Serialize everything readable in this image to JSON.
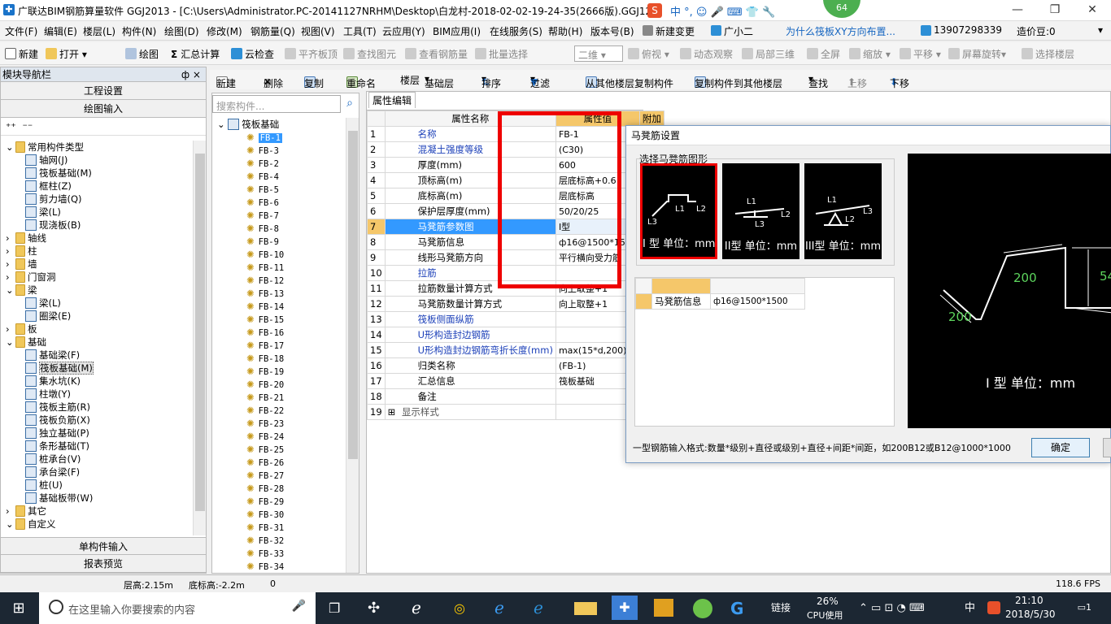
{
  "window": {
    "title": "广联达BIM钢筋算量软件 GGJ2013 - [C:\\Users\\Administrator.PC-20141127NRHM\\Desktop\\白龙村-2018-02-02-19-24-35(2666版).GGJ12]",
    "badge": "64"
  },
  "menu": {
    "items": [
      "文件(F)",
      "编辑(E)",
      "楼层(L)",
      "构件(N)",
      "绘图(D)",
      "修改(M)",
      "钢筋量(Q)",
      "视图(V)",
      "工具(T)",
      "云应用(Y)",
      "BIM应用(I)",
      "在线服务(S)",
      "帮助(H)",
      "版本号(B)"
    ],
    "new_change": "新建变更",
    "xiaoer": "广小二",
    "question": "为什么筏板XY方向布置...",
    "phone": "13907298339",
    "price_bean": "造价豆:0"
  },
  "toolbar1": {
    "new": "新建",
    "open": "打开",
    "draw": "绘图",
    "calc": "汇总计算",
    "cloud_check": "云检查",
    "align_top": "平齐板顶",
    "find_elem": "查找图元",
    "view_rebar": "查看钢筋量",
    "batch_select": "批量选择",
    "view_mode": "二维",
    "top_view": "俯视",
    "dynamic": "动态观察",
    "local_3d": "局部三维",
    "fullscreen": "全屏",
    "zoom": "缩放",
    "pan": "平移",
    "rotate": "屏幕旋转",
    "select_floor": "选择楼层"
  },
  "toolbar2": {
    "new": "新建",
    "delete": "删除",
    "copy": "复制",
    "rename": "重命名",
    "floor_label": "楼层",
    "floor_value": "基础层",
    "sort": "排序",
    "filter": "过滤",
    "copy_from": "从其他楼层复制构件",
    "copy_to": "复制构件到其他楼层",
    "find": "查找",
    "up": "上移",
    "down": "下移"
  },
  "nav": {
    "title": "模块导航栏",
    "pin": "ф ×",
    "project_settings": "工程设置",
    "drawing_input": "绘图输入",
    "single_input": "单构件输入",
    "report_preview": "报表预览",
    "tree": [
      {
        "label": "常用构件类型",
        "level": 0,
        "kind": "folder",
        "open": true
      },
      {
        "label": "轴网(J)",
        "level": 1,
        "kind": "item"
      },
      {
        "label": "筏板基础(M)",
        "level": 1,
        "kind": "item"
      },
      {
        "label": "框柱(Z)",
        "level": 1,
        "kind": "item"
      },
      {
        "label": "剪力墙(Q)",
        "level": 1,
        "kind": "item"
      },
      {
        "label": "梁(L)",
        "level": 1,
        "kind": "item"
      },
      {
        "label": "现浇板(B)",
        "level": 1,
        "kind": "item"
      },
      {
        "label": "轴线",
        "level": 0,
        "kind": "folder"
      },
      {
        "label": "柱",
        "level": 0,
        "kind": "folder"
      },
      {
        "label": "墙",
        "level": 0,
        "kind": "folder"
      },
      {
        "label": "门窗洞",
        "level": 0,
        "kind": "folder"
      },
      {
        "label": "梁",
        "level": 0,
        "kind": "folder",
        "open": true
      },
      {
        "label": "梁(L)",
        "level": 1,
        "kind": "item"
      },
      {
        "label": "圈梁(E)",
        "level": 1,
        "kind": "item"
      },
      {
        "label": "板",
        "level": 0,
        "kind": "folder"
      },
      {
        "label": "基础",
        "level": 0,
        "kind": "folder",
        "open": true
      },
      {
        "label": "基础梁(F)",
        "level": 1,
        "kind": "item"
      },
      {
        "label": "筏板基础(M)",
        "level": 1,
        "kind": "item",
        "selected": true
      },
      {
        "label": "集水坑(K)",
        "level": 1,
        "kind": "item"
      },
      {
        "label": "柱墩(Y)",
        "level": 1,
        "kind": "item"
      },
      {
        "label": "筏板主筋(R)",
        "level": 1,
        "kind": "item"
      },
      {
        "label": "筏板负筋(X)",
        "level": 1,
        "kind": "item"
      },
      {
        "label": "独立基础(P)",
        "level": 1,
        "kind": "item"
      },
      {
        "label": "条形基础(T)",
        "level": 1,
        "kind": "item"
      },
      {
        "label": "桩承台(V)",
        "level": 1,
        "kind": "item"
      },
      {
        "label": "承台梁(F)",
        "level": 1,
        "kind": "item"
      },
      {
        "label": "桩(U)",
        "level": 1,
        "kind": "item"
      },
      {
        "label": "基础板带(W)",
        "level": 1,
        "kind": "item"
      },
      {
        "label": "其它",
        "level": 0,
        "kind": "folder"
      },
      {
        "label": "自定义",
        "level": 0,
        "kind": "folder",
        "open": true
      }
    ]
  },
  "components": {
    "search_placeholder": "搜索构件...",
    "root": "筏板基础",
    "items": [
      "FB-1",
      "FB-3",
      "FB-2",
      "FB-4",
      "FB-5",
      "FB-6",
      "FB-7",
      "FB-8",
      "FB-9",
      "FB-10",
      "FB-11",
      "FB-12",
      "FB-13",
      "FB-14",
      "FB-15",
      "FB-16",
      "FB-17",
      "FB-18",
      "FB-19",
      "FB-20",
      "FB-21",
      "FB-22",
      "FB-23",
      "FB-24",
      "FB-25",
      "FB-26",
      "FB-27",
      "FB-28",
      "FB-29",
      "FB-30",
      "FB-31",
      "FB-32",
      "FB-33",
      "FB-34"
    ]
  },
  "properties": {
    "tab": "属性编辑",
    "col_name": "属性名称",
    "col_value": "属性值",
    "col_extra": "附加",
    "rows": [
      {
        "no": "1",
        "name": "名称",
        "value": "FB-1",
        "blue": true
      },
      {
        "no": "2",
        "name": "混凝土强度等级",
        "value": "(C30)",
        "blue": true
      },
      {
        "no": "3",
        "name": "厚度(mm)",
        "value": "600",
        "blue": false
      },
      {
        "no": "4",
        "name": "顶标高(m)",
        "value": "层底标高+0.6",
        "blue": false
      },
      {
        "no": "5",
        "name": "底标高(m)",
        "value": "层底标高",
        "blue": false
      },
      {
        "no": "6",
        "name": "保护层厚度(mm)",
        "value": "50/20/25",
        "blue": false
      },
      {
        "no": "7",
        "name": "马凳筋参数图",
        "value": "I型",
        "blue": false,
        "selected": true
      },
      {
        "no": "8",
        "name": "马凳筋信息",
        "value": "ф16@1500*1500",
        "blue": false
      },
      {
        "no": "9",
        "name": "线形马凳筋方向",
        "value": "平行横向受力筋",
        "blue": false
      },
      {
        "no": "10",
        "name": "拉筋",
        "value": "",
        "blue": true
      },
      {
        "no": "11",
        "name": "拉筋数量计算方式",
        "value": "向上取整+1",
        "blue": false
      },
      {
        "no": "12",
        "name": "马凳筋数量计算方式",
        "value": "向上取整+1",
        "blue": false
      },
      {
        "no": "13",
        "name": "筏板侧面纵筋",
        "value": "",
        "blue": true
      },
      {
        "no": "14",
        "name": "U形构造封边钢筋",
        "value": "",
        "blue": true
      },
      {
        "no": "15",
        "name": "U形构造封边钢筋弯折长度(mm)",
        "value": "max(15*d,200)",
        "blue": true
      },
      {
        "no": "16",
        "name": "归类名称",
        "value": "(FB-1)",
        "blue": false
      },
      {
        "no": "17",
        "name": "汇总信息",
        "value": "筏板基础",
        "blue": false
      },
      {
        "no": "18",
        "name": "备注",
        "value": "",
        "blue": false
      },
      {
        "no": "19",
        "name": "显示样式",
        "value": "",
        "blue": false,
        "expand": true
      }
    ]
  },
  "dialog": {
    "title": "马凳筋设置",
    "group_label": "选择马凳筋图形",
    "shapes": [
      {
        "label": "I 型  单位：mm",
        "selected": true
      },
      {
        "label": "II型  单位：mm",
        "selected": false
      },
      {
        "label": "III型  单位：mm",
        "selected": false
      }
    ],
    "info_label": "马凳筋信息",
    "info_value": "ф16@1500*1500",
    "preview_dim1": "200",
    "preview_dim2": "200",
    "preview_dim3": "54",
    "preview_caption": "I 型  单位：mm",
    "hint": "一型钢筋输入格式:数量*级别+直径或级别+直径+间距*间距，如200B12或B12@1000*1000",
    "ok": "确定"
  },
  "status": {
    "floor_height": "层高:2.15m",
    "bottom_height": "底标高:-2.2m",
    "zero": "0",
    "fps": "118.6 FPS"
  },
  "taskbar": {
    "search_placeholder": "在这里输入你要搜索的内容",
    "link": "链接",
    "cpu_pct": "26%",
    "cpu_label": "CPU使用",
    "ime": "中",
    "time": "21:10",
    "date": "2018/5/30",
    "notify": "1"
  },
  "colors": {
    "accent": "#3399ff",
    "highlight": "#e00000",
    "header": "#f5c76a",
    "selected_row": "#3399ff"
  }
}
